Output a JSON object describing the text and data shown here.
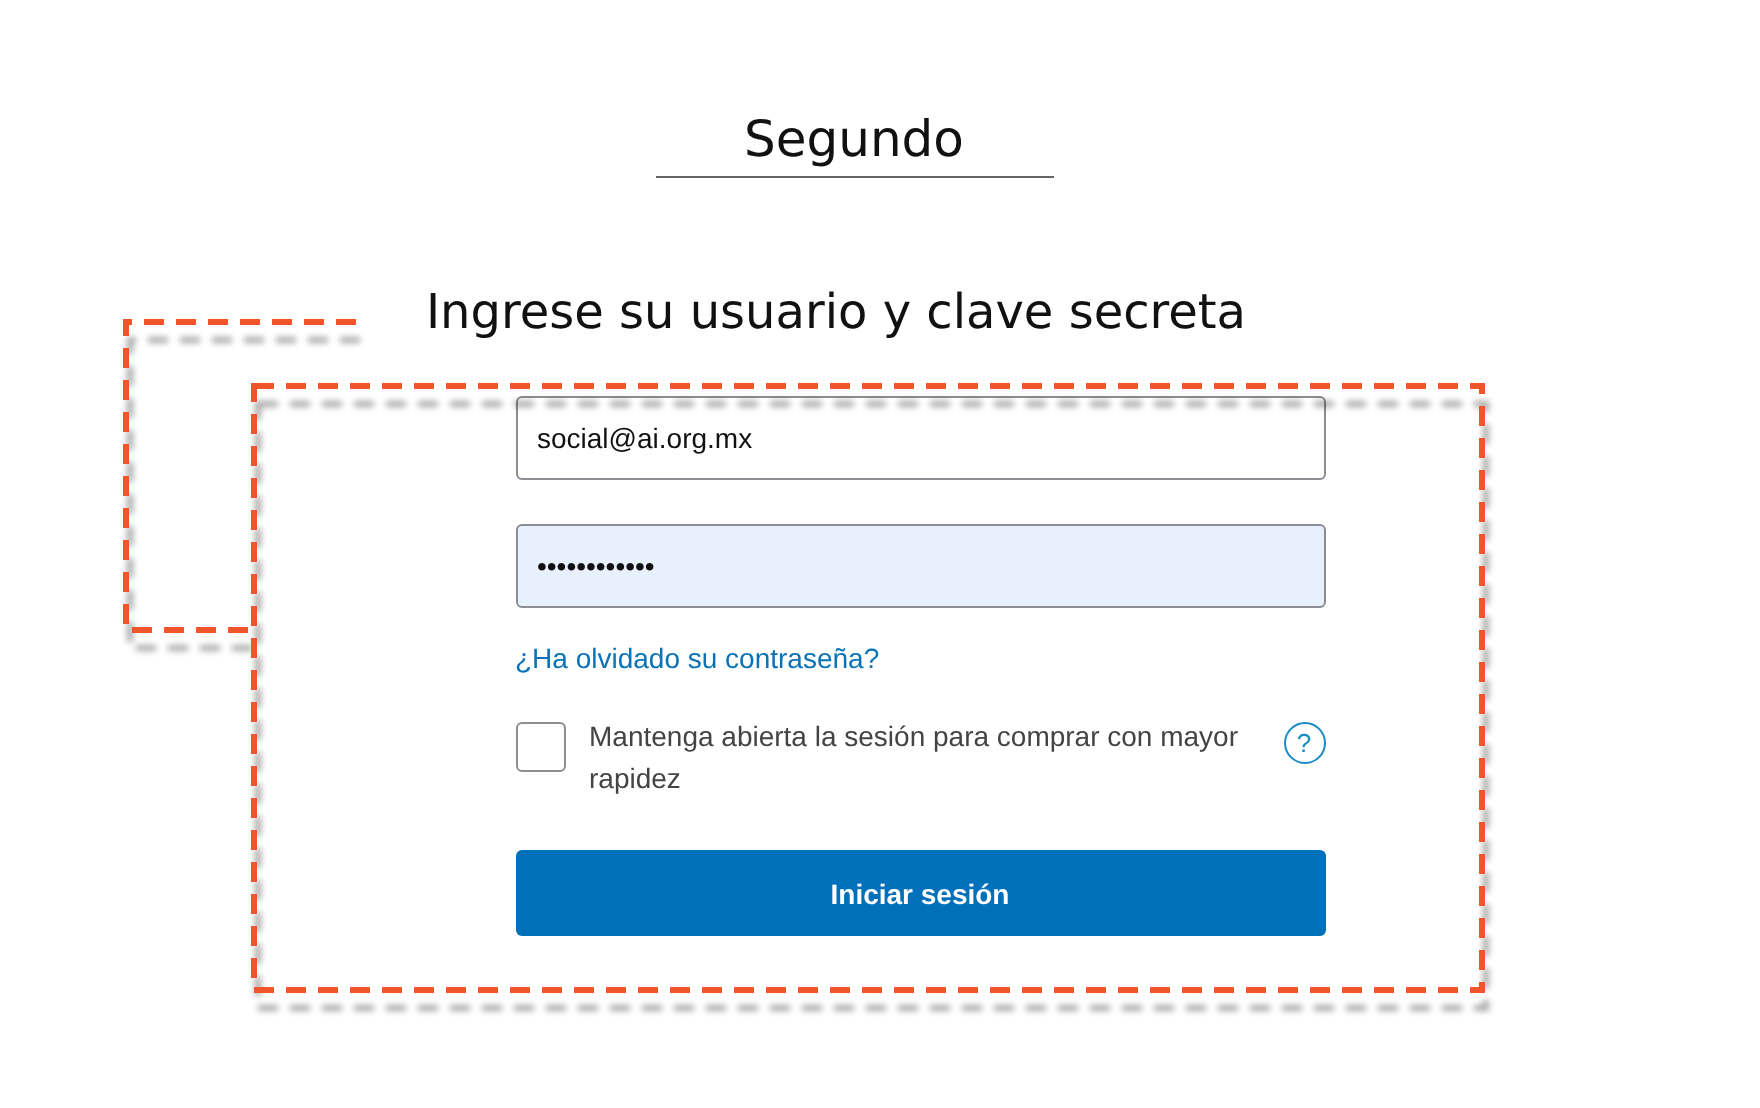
{
  "step_title": "Segundo",
  "instruction": "Ingrese su usuario y clave secreta",
  "login_form": {
    "email": {
      "value": "social@ai.org.mx"
    },
    "password": {
      "value": "••••••••••••",
      "autofilled": true
    },
    "forgot_link": "¿Ha olvidado su contraseña?",
    "remember": {
      "label": "Mantenga abierta la sesión para comprar con mayor rapidez",
      "checked": false,
      "help": "?"
    },
    "submit": "Iniciar sesión"
  }
}
